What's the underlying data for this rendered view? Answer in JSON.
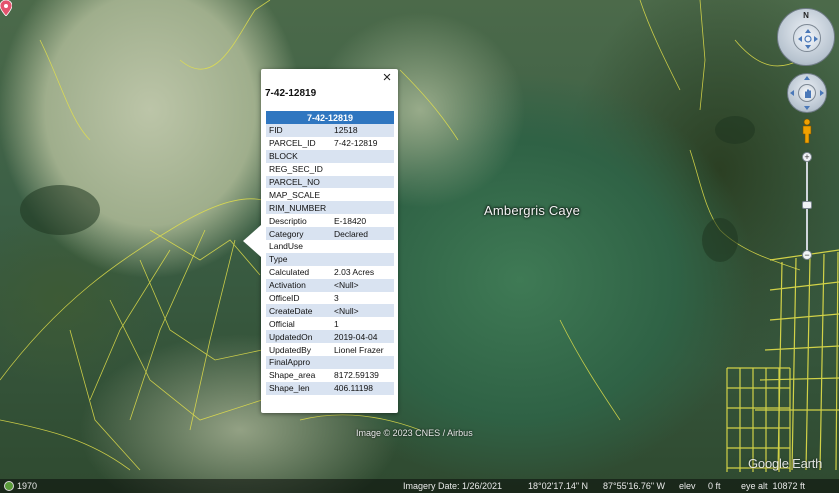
{
  "map": {
    "place_label": "Ambergris Caye",
    "attribution": "Image © 2023 CNES / Airbus",
    "logo": "Google Earth"
  },
  "balloon": {
    "title": "7-42-12819",
    "header": "7-42-12819",
    "close_icon": "×",
    "rows": [
      {
        "key": "FID",
        "value": "12518"
      },
      {
        "key": "PARCEL_ID",
        "value": "7-42-12819"
      },
      {
        "key": "BLOCK",
        "value": ""
      },
      {
        "key": "REG_SEC_ID",
        "value": ""
      },
      {
        "key": "PARCEL_NO",
        "value": ""
      },
      {
        "key": "MAP_SCALE",
        "value": ""
      },
      {
        "key": "RIM_NUMBER",
        "value": ""
      },
      {
        "key": "Descriptio",
        "value": "E-18420"
      },
      {
        "key": "Category",
        "value": "Declared"
      },
      {
        "key": "LandUse",
        "value": ""
      },
      {
        "key": "Type",
        "value": ""
      },
      {
        "key": "Calculated",
        "value": "2.03 Acres"
      },
      {
        "key": "Activation",
        "value": "<Null>"
      },
      {
        "key": "OfficeID",
        "value": "3"
      },
      {
        "key": "CreateDate",
        "value": "<Null>"
      },
      {
        "key": "Official",
        "value": "1"
      },
      {
        "key": "UpdatedOn",
        "value": "2019-04-04"
      },
      {
        "key": "UpdatedBy",
        "value": "Lionel Frazer"
      },
      {
        "key": "FinalAppro",
        "value": ""
      },
      {
        "key": "Shape_area",
        "value": "8172.59139"
      },
      {
        "key": "Shape_len",
        "value": "406.11198"
      }
    ]
  },
  "nav": {
    "north_label": "N",
    "zoom_in": "+",
    "zoom_out": "−",
    "icons": [
      "compass-ring-icon",
      "look-joystick-icon",
      "move-hand-icon",
      "pegman-icon",
      "zoom-slider-icon"
    ]
  },
  "status": {
    "year": "1970",
    "imagery_date": "Imagery Date: 1/26/2021",
    "lat": "18°02'17.14\" N",
    "lon": "87°55'16.76\" W",
    "elev": "elev     0 ft",
    "eye_alt": "eye alt  10872 ft"
  },
  "colors": {
    "parcel_line": "#e3e04a",
    "table_header": "#2f76c0",
    "table_alt_row": "#d9e3f1",
    "pin": "#e3546e"
  }
}
